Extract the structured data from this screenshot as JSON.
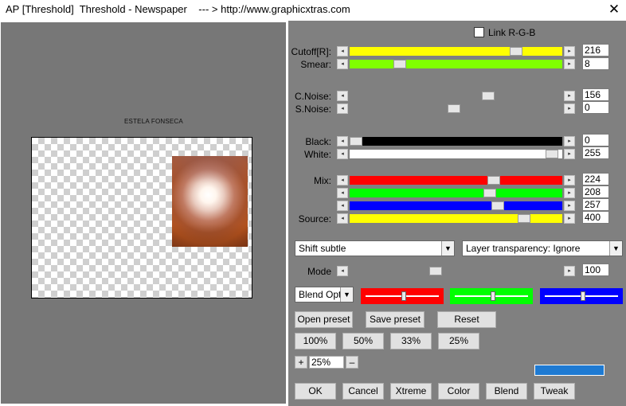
{
  "window": {
    "title": "AP [Threshold]  Threshold - Newspaper    --- > http://www.graphicxtras.com",
    "close_glyph": "✕"
  },
  "preview": {
    "caption": "ESTELA FONSECA"
  },
  "link_rgb": {
    "label": "Link R-G-B",
    "checked": false
  },
  "sliders": {
    "cutoff": {
      "label": "Cutoff[R]:",
      "value": "216",
      "fill": "#ffff00",
      "fraction": 0.8
    },
    "smear": {
      "label": "Smear:",
      "value": "8",
      "fill": "#80ff00",
      "fraction": 0.22
    },
    "cnoise": {
      "label": "C.Noise:",
      "value": "156",
      "fill": "#808080",
      "fraction": 0.66
    },
    "snoise": {
      "label": "S.Noise:",
      "value": "0",
      "fill": "#808080",
      "fraction": 0.49
    },
    "black": {
      "label": "Black:",
      "value": "0",
      "fill": "#000000",
      "fraction": 0.0
    },
    "white": {
      "label": "White:",
      "value": "255",
      "fill": "#ffffff",
      "fraction": 0.98
    },
    "mix_r": {
      "label": "Mix:",
      "value": "224",
      "fill": "#ff0000",
      "fraction": 0.69
    },
    "mix_g": {
      "label": "",
      "value": "208",
      "fill": "#00ff00",
      "fraction": 0.67
    },
    "mix_b": {
      "label": "",
      "value": "257",
      "fill": "#0000ff",
      "fraction": 0.71
    },
    "source": {
      "label": "Source:",
      "value": "400",
      "fill": "#ffff00",
      "fraction": 0.84
    },
    "mode": {
      "label": "Mode",
      "value": "100",
      "fill": "#808080",
      "fraction": 0.4
    }
  },
  "dropdowns": {
    "shift": "Shift subtle",
    "layer": "Layer transparency: Ignore",
    "blend": "Blend Optio"
  },
  "color_balance": {
    "red": {
      "color": "#ff0000",
      "fraction": 0.52
    },
    "green": {
      "color": "#00ff00",
      "fraction": 0.52
    },
    "blue": {
      "color": "#0000ff",
      "fraction": 0.52
    }
  },
  "preset_buttons": {
    "open": "Open preset",
    "save": "Save preset",
    "reset": "Reset"
  },
  "zoom_buttons": [
    "100%",
    "50%",
    "33%",
    "25%"
  ],
  "zoom": {
    "plus": "+",
    "value": "25%",
    "minus": "–"
  },
  "accent": "#1e7ad2",
  "bottom_buttons": {
    "ok": "OK",
    "cancel": "Cancel",
    "xtreme": "Xtreme",
    "color": "Color",
    "blend": "Blend",
    "tweak": "Tweak"
  },
  "icons": {
    "arrow_left": "◂",
    "arrow_right": "▸",
    "dropdown": "▼"
  }
}
